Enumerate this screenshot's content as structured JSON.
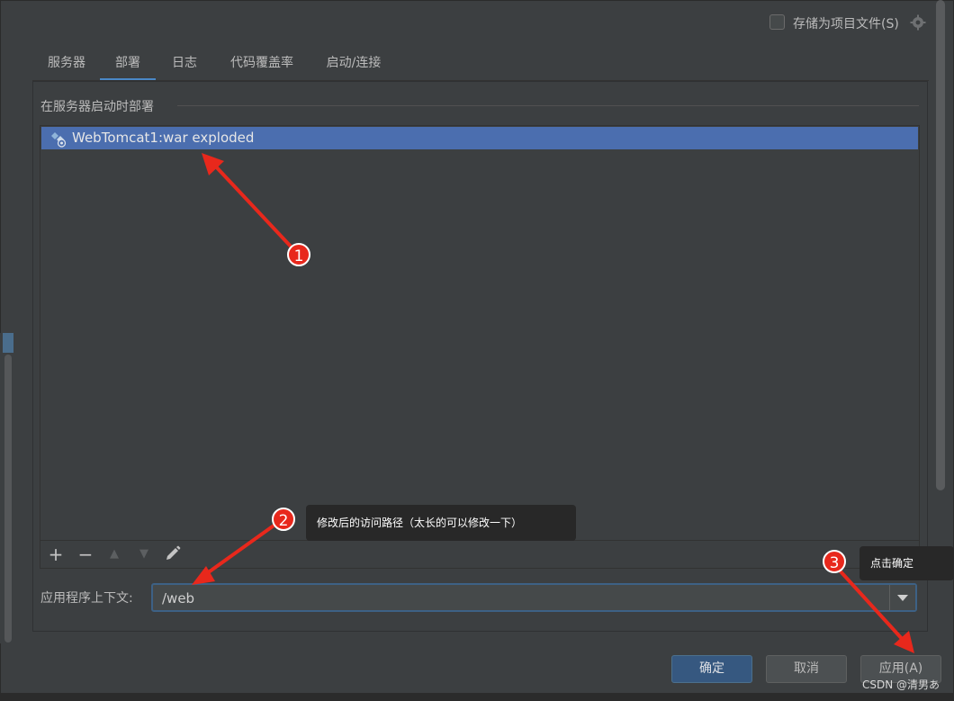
{
  "dialog": {
    "store_as_project_file_label": "存储为项目文件(S)",
    "store_as_project_file_checked": false
  },
  "tabs": [
    {
      "label": "服务器",
      "active": false
    },
    {
      "label": "部署",
      "active": true
    },
    {
      "label": "日志",
      "active": false
    },
    {
      "label": "代码覆盖率",
      "active": false
    },
    {
      "label": "启动/连接",
      "active": false
    }
  ],
  "deploy": {
    "section_title": "在服务器启动时部署",
    "artifacts": [
      {
        "name": "WebTomcat1:war exploded",
        "selected": true,
        "icon": "artifact-icon"
      }
    ],
    "toolbar": {
      "add": "+",
      "remove": "−",
      "up": "▲",
      "down": "▼",
      "edit_icon": "pencil-icon"
    },
    "context_label": "应用程序上下文:",
    "context_value": "/web"
  },
  "buttons": {
    "ok": "确定",
    "cancel": "取消",
    "apply": "应用(A)"
  },
  "annotations": {
    "badge1": "1",
    "badge2": "2",
    "badge3": "3",
    "tooltip_path": "修改后的访问路径（太长的可以修改一下）",
    "tooltip_confirm": "点击确定",
    "watermark": "CSDN @清男あ",
    "color": "#e8281c"
  }
}
